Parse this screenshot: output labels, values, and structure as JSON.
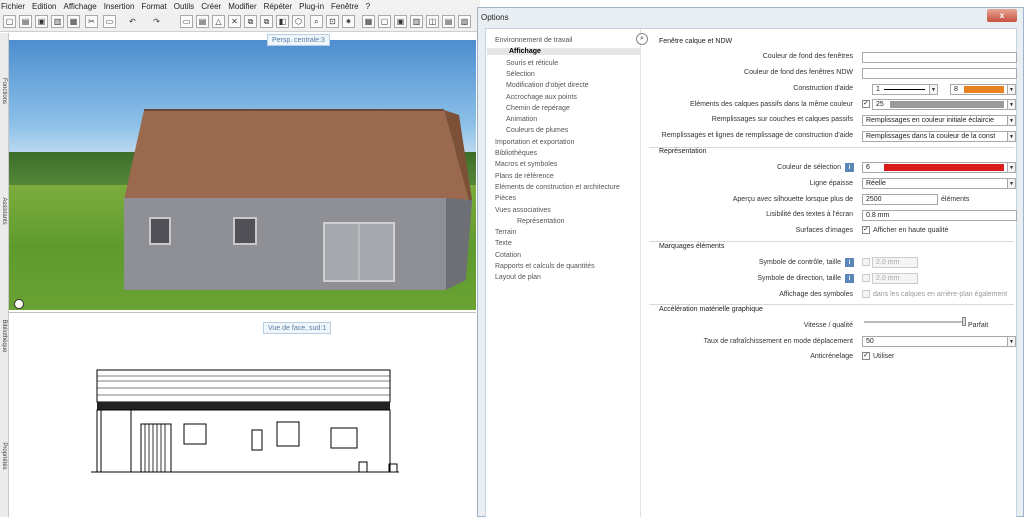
{
  "menu": [
    "Fichier",
    "Edition",
    "Affichage",
    "Insertion",
    "Format",
    "Outils",
    "Créer",
    "Modifier",
    "Répéter",
    "Plug-in",
    "Fenêtre",
    "?"
  ],
  "side_tabs": [
    "Fonctions",
    "Assistants",
    "Bibliothèque",
    "Propriétés"
  ],
  "views": {
    "persp": "Persp. centrale:3",
    "face": "Vue de face, sud:1"
  },
  "dialog": {
    "title": "Options",
    "close": "x",
    "tree": [
      {
        "label": "Environnement de travail",
        "level": 0
      },
      {
        "label": "Affichage",
        "level": 1,
        "selected": true
      },
      {
        "label": "Souris et réticule",
        "level": 1
      },
      {
        "label": "Sélection",
        "level": 1
      },
      {
        "label": "Modification d'objet directe",
        "level": 1
      },
      {
        "label": "Accrochage aux points",
        "level": 1
      },
      {
        "label": "Chemin de repérage",
        "level": 1
      },
      {
        "label": "Animation",
        "level": 1
      },
      {
        "label": "Couleurs de plumes",
        "level": 1
      },
      {
        "label": "Importation et exportation",
        "level": 0
      },
      {
        "label": "Bibliothèques",
        "level": 0
      },
      {
        "label": "Macros et symboles",
        "level": 0
      },
      {
        "label": "Plans de référence",
        "level": 0
      },
      {
        "label": "Eléments de construction et architecture",
        "level": 0
      },
      {
        "label": "Pièces",
        "level": 0
      },
      {
        "label": "Vues associatives",
        "level": 0
      },
      {
        "label": "Représentation",
        "level": 2
      },
      {
        "label": "Terrain",
        "level": 0
      },
      {
        "label": "Texte",
        "level": 0
      },
      {
        "label": "Cotation",
        "level": 0
      },
      {
        "label": "Rapports et calculs de quantités",
        "level": 0
      },
      {
        "label": "Layout de plan",
        "level": 0
      }
    ],
    "sections": {
      "s1": "Fenêtre calque et NDW",
      "s2": "Représentation",
      "s3": "Marquages éléments",
      "s4": "Accélération matérielle graphique"
    },
    "labels": {
      "bg_win": "Couleur de fond des fenêtres",
      "bg_ndw": "Couleur de fond des fenêtres NDW",
      "help_constr": "Construction d'aide",
      "passive": "Eléments des calques passifs dans la même couleur",
      "fill_passive": "Remplissages sur couches et calques passifs",
      "fill_lines": "Remplissages et lignes de remplissage de construction d'aide",
      "sel_color": "Couleur de sélection",
      "thick": "Ligne épaisse",
      "preview": "Aperçu avec silhouette lorsque plus de",
      "legib": "Lisibilité des textes à l'écran",
      "surfaces": "Surfaces d'images",
      "ctrl_sym": "Symbole de contrôle, taille",
      "dir_sym": "Symbole de direction, taille",
      "show_sym": "Affichage des symboles",
      "speed": "Vitesse / qualité",
      "refresh": "Taux de rafraîchissement en mode déplacement",
      "antialias": "Anticrénelage"
    },
    "values": {
      "help_pen": "1",
      "help_color_num": "8",
      "passive_num": "25",
      "fill_passive_val": "Remplissages en couleur initiale éclaircie",
      "fill_lines_val": "Remplissages dans la couleur de la const",
      "sel_num": "6",
      "thick_val": "Réelle",
      "preview_val": "2500",
      "preview_unit": "éléments",
      "legib_val": "0.8 mm",
      "surfaces_txt": "Afficher en haute qualité",
      "ctrl_val": "2.0 mm",
      "dir_val": "2.0 mm",
      "show_txt": "dans les calques en arrière-plan également",
      "speed_txt": "Parfait",
      "refresh_val": "50",
      "antialias_txt": "Utiliser",
      "check": "✓",
      "info": "i",
      "arrow": "▼"
    },
    "colors": {
      "help_color": "#e8821e",
      "sel_color": "#d81c1c",
      "passive_color": "#9a9a9a"
    }
  }
}
